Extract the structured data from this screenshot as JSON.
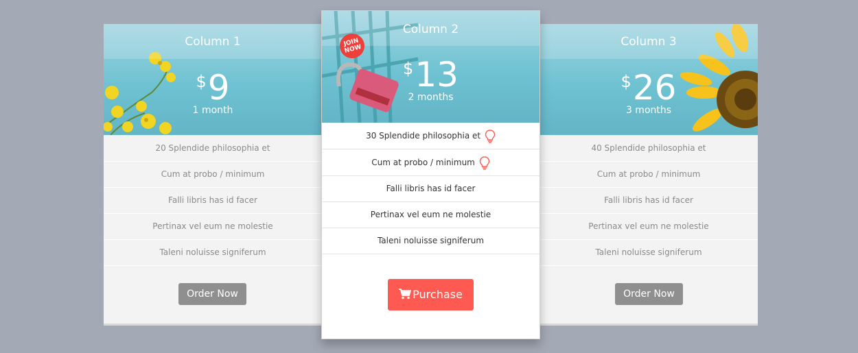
{
  "plans": [
    {
      "title": "Column 1",
      "currency": "$",
      "amount": "9",
      "period": "1 month",
      "features": [
        "20 Splendide philosophia et",
        "Cum at probo / minimum",
        "Falli libris has id facer",
        "Pertinax vel eum ne molestie",
        "Taleni noluisse signiferum"
      ],
      "button": "Order Now"
    },
    {
      "title": "Column 2",
      "currency": "$",
      "amount": "13",
      "period": "2 months",
      "badge": "JOIN NOW",
      "features": [
        "30 Splendide philosophia et",
        "Cum at probo / minimum",
        "Falli libris has id facer",
        "Pertinax vel eum ne molestie",
        "Taleni noluisse signiferum"
      ],
      "button": "Purchase"
    },
    {
      "title": "Column 3",
      "currency": "$",
      "amount": "26",
      "period": "3 months",
      "features": [
        "40 Splendide philosophia et",
        "Cum at probo / minimum",
        "Falli libris has id facer",
        "Pertinax vel eum ne molestie",
        "Taleni noluisse signiferum"
      ],
      "button": "Order Now"
    }
  ],
  "icons": {
    "feature_highlight": "lightbulb-icon",
    "purchase": "cart-icon"
  },
  "colors": {
    "background": "#a3a9b5",
    "accent": "#ff5a52",
    "badge": "#ef3f3a",
    "order_button": "#8f8f8f"
  }
}
